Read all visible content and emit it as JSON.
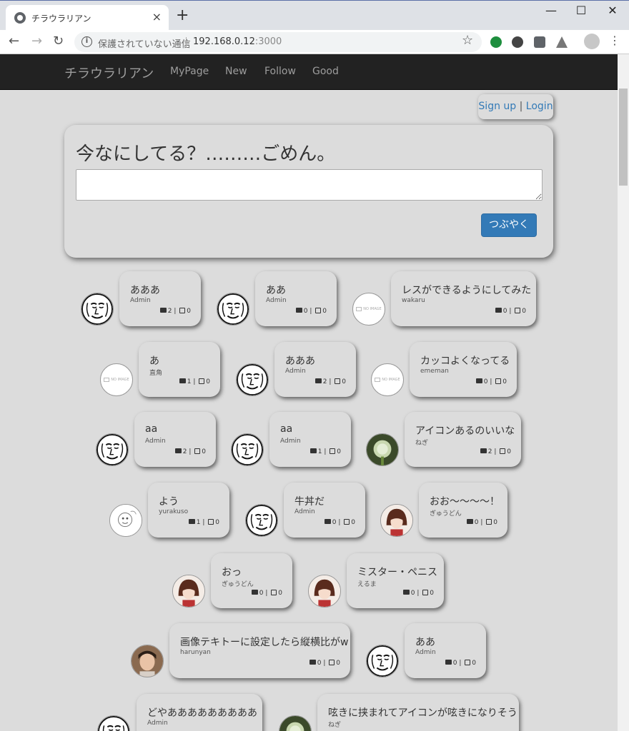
{
  "browser": {
    "tab_title": "チラウラリアン",
    "tab_close": "×",
    "new_tab": "+",
    "minimize": "—",
    "maximize": "☐",
    "close": "✕",
    "insecure_label": "保護されていない通信",
    "url_host": "192.168.0.12",
    "url_port": ":3000"
  },
  "navbar": {
    "brand": "チラウラリアン",
    "links": [
      "MyPage",
      "New",
      "Follow",
      "Good"
    ]
  },
  "auth": {
    "signup": "Sign up",
    "sep": " | ",
    "login": "Login"
  },
  "post": {
    "heading": "今なにしてる？………ごめん。",
    "textarea_value": "",
    "submit_label": "つぶやく"
  },
  "tweets": [
    {
      "text": "あああ",
      "user": "Admin",
      "comments": "2",
      "goods": "0",
      "avatar": "face-icon"
    },
    {
      "text": "ああ",
      "user": "Admin",
      "comments": "0",
      "goods": "0",
      "avatar": "face-icon"
    },
    {
      "text": "レスができるようにしてみた",
      "user": "wakaru",
      "comments": "0",
      "goods": "0",
      "avatar": "noimage-icon"
    },
    {
      "text": "あ",
      "user": "直角",
      "comments": "1",
      "goods": "0",
      "avatar": "noimage-icon"
    },
    {
      "text": "あああ",
      "user": "Admin",
      "comments": "2",
      "goods": "0",
      "avatar": "face-icon"
    },
    {
      "text": "カッコよくなってる",
      "user": "ememan",
      "comments": "0",
      "goods": "0",
      "avatar": "noimage-icon"
    },
    {
      "text": "aa",
      "user": "Admin",
      "comments": "2",
      "goods": "0",
      "avatar": "face-icon"
    },
    {
      "text": "aa",
      "user": "Admin",
      "comments": "1",
      "goods": "0",
      "avatar": "face-icon"
    },
    {
      "text": "アイコンあるのいいな",
      "user": "ねぎ",
      "comments": "2",
      "goods": "0",
      "avatar": "onion-photo"
    },
    {
      "text": "よう",
      "user": "yurakuso",
      "comments": "1",
      "goods": "0",
      "avatar": "sketch-icon"
    },
    {
      "text": "牛丼だ",
      "user": "Admin",
      "comments": "0",
      "goods": "0",
      "avatar": "face-icon"
    },
    {
      "text": "おお〜〜〜〜！",
      "user": "ぎゅうどん",
      "comments": "0",
      "goods": "0",
      "avatar": "anime-girl-photo"
    },
    {
      "text": "おっ",
      "user": "ぎゅうどん",
      "comments": "0",
      "goods": "0",
      "avatar": "anime-girl-photo"
    },
    {
      "text": "ミスター・ペニス",
      "user": "えるま",
      "comments": "0",
      "goods": "0",
      "avatar": "anime-girl-photo"
    },
    {
      "text": "画像テキトーに設定したら縦横比がw",
      "user": "harunyan",
      "comments": "0",
      "goods": "0",
      "avatar": "person-photo"
    },
    {
      "text": "ああ",
      "user": "Admin",
      "comments": "0",
      "goods": "0",
      "avatar": "face-icon"
    },
    {
      "text": "どやあああああああああ",
      "user": "Admin",
      "comments": "",
      "goods": "",
      "avatar": "face-icon"
    },
    {
      "text": "呟きに挟まれてアイコンが呟きになりそう",
      "user": "ねぎ",
      "comments": "",
      "goods": "",
      "avatar": "onion-photo"
    }
  ],
  "stat_sep": " | ",
  "noimage_text": "NO IMAGE"
}
